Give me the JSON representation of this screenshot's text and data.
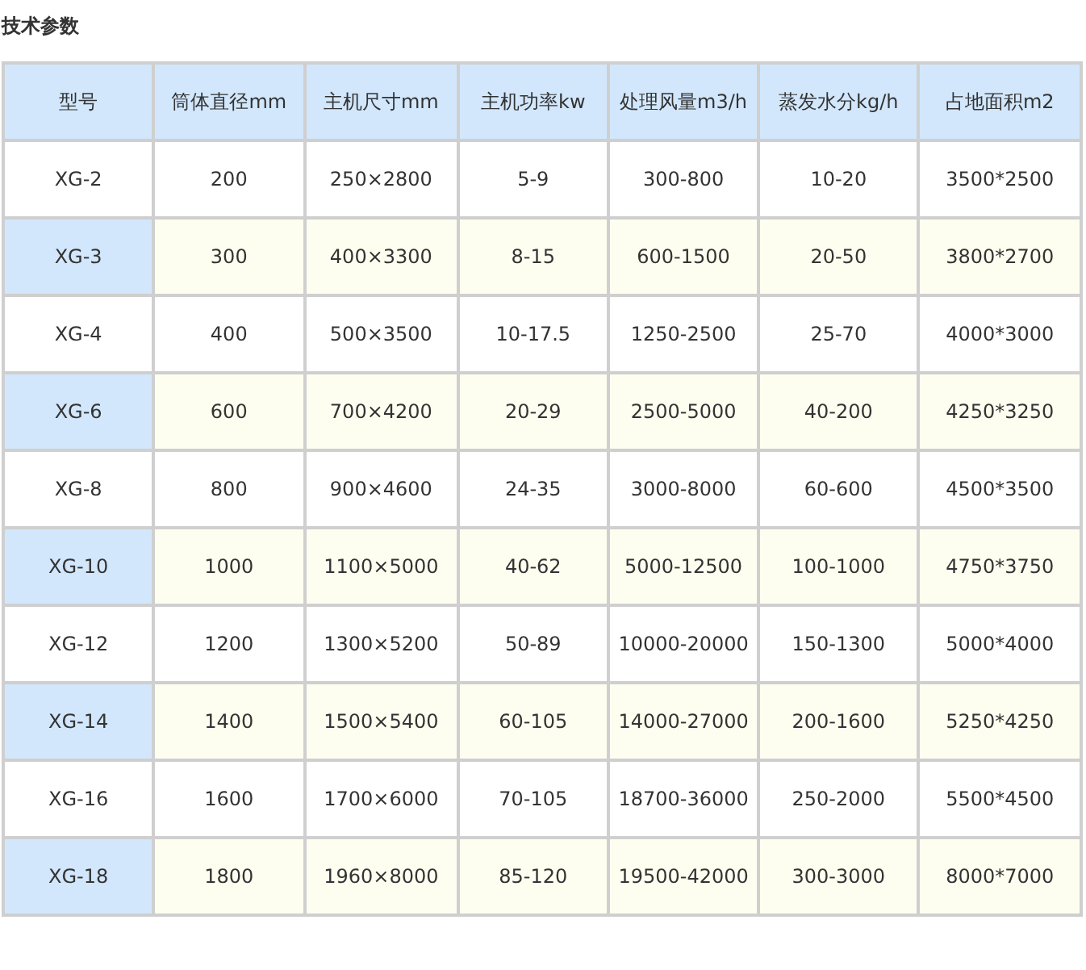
{
  "title": "技术参数",
  "table": {
    "columns": [
      "型号",
      "筒体直径mm",
      "主机尺寸mm",
      "主机功率kw",
      "处理风量m3/h",
      "蒸发水分kg/h",
      "占地面积m2"
    ],
    "rows": [
      {
        "highlighted": false,
        "cells": [
          "XG-2",
          "200",
          "250×2800",
          "5-9",
          "300-800",
          "10-20",
          "3500*2500"
        ]
      },
      {
        "highlighted": true,
        "cells": [
          "XG-3",
          "300",
          "400×3300",
          "8-15",
          "600-1500",
          "20-50",
          "3800*2700"
        ]
      },
      {
        "highlighted": false,
        "cells": [
          "XG-4",
          "400",
          "500×3500",
          "10-17.5",
          "1250-2500",
          "25-70",
          "4000*3000"
        ]
      },
      {
        "highlighted": true,
        "cells": [
          "XG-6",
          "600",
          "700×4200",
          "20-29",
          "2500-5000",
          "40-200",
          "4250*3250"
        ]
      },
      {
        "highlighted": false,
        "cells": [
          "XG-8",
          "800",
          "900×4600",
          "24-35",
          "3000-8000",
          "60-600",
          "4500*3500"
        ]
      },
      {
        "highlighted": true,
        "cells": [
          "XG-10",
          "1000",
          "1100×5000",
          "40-62",
          "5000-12500",
          "100-1000",
          "4750*3750"
        ]
      },
      {
        "highlighted": false,
        "cells": [
          "XG-12",
          "1200",
          "1300×5200",
          "50-89",
          "10000-20000",
          "150-1300",
          "5000*4000"
        ]
      },
      {
        "highlighted": true,
        "cells": [
          "XG-14",
          "1400",
          "1500×5400",
          "60-105",
          "14000-27000",
          "200-1600",
          "5250*4250"
        ]
      },
      {
        "highlighted": false,
        "cells": [
          "XG-16",
          "1600",
          "1700×6000",
          "70-105",
          "18700-36000",
          "250-2000",
          "5500*4500"
        ]
      },
      {
        "highlighted": true,
        "cells": [
          "XG-18",
          "1800",
          "1960×8000",
          "85-120",
          "19500-42000",
          "300-3000",
          "8000*7000"
        ]
      }
    ]
  }
}
